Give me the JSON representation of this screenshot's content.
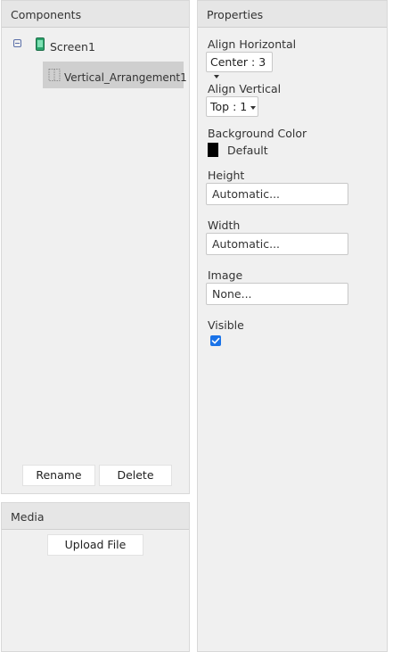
{
  "components": {
    "header": "Components",
    "tree": {
      "screen": "Screen1",
      "child": "Vertical_Arrangement1"
    },
    "rename_label": "Rename",
    "delete_label": "Delete"
  },
  "media": {
    "header": "Media",
    "upload_label": "Upload File"
  },
  "properties": {
    "header": "Properties",
    "align_horizontal": {
      "label": "Align Horizontal",
      "value": "Center : 3"
    },
    "align_vertical": {
      "label": "Align Vertical",
      "value": "Top : 1"
    },
    "background_color": {
      "label": "Background Color",
      "value": "Default",
      "swatch": "#000000"
    },
    "height": {
      "label": "Height",
      "value": "Automatic..."
    },
    "width": {
      "label": "Width",
      "value": "Automatic..."
    },
    "image": {
      "label": "Image",
      "value": "None..."
    },
    "visible": {
      "label": "Visible",
      "checked": true
    }
  },
  "colors": {
    "accent": "#1a73e8",
    "panel": "#f0f0f0",
    "header": "#e6e6e6",
    "selected": "#cfcfcf"
  }
}
